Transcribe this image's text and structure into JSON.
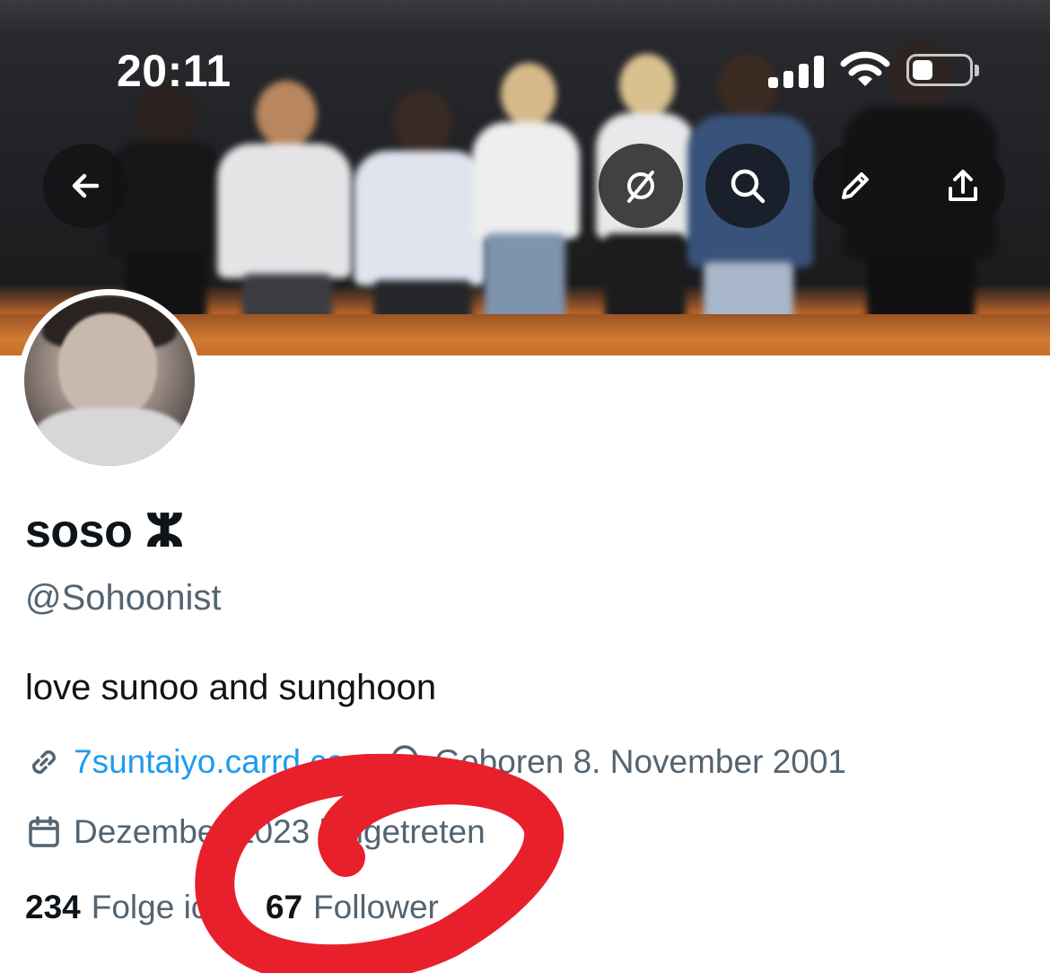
{
  "status_bar": {
    "time": "20:11"
  },
  "header_actions": {
    "back": "arrow-left-icon",
    "toolbar": [
      "translate-icon",
      "search-icon",
      "edit-icon",
      "share-icon"
    ]
  },
  "profile": {
    "display_name": "soso ⵣ",
    "handle": "@Sohoonist",
    "bio": "love sunoo and sunghoon",
    "link": "7suntaiyo.carrd.co",
    "birthday": "Geboren 8. November 2001",
    "joined": "Dezember 2023 beigetreten"
  },
  "stats": {
    "following_count": "234",
    "following_label": "Folge ich",
    "followers_count": "67",
    "followers_label": "Follower"
  },
  "colors": {
    "link_blue": "#1d9bf0",
    "secondary_text": "#536471",
    "primary_text": "#0f1419",
    "marker_red": "#e8202c"
  }
}
